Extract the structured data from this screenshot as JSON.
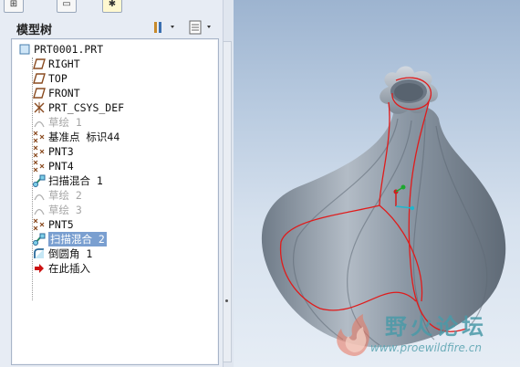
{
  "panel": {
    "title": "模型树"
  },
  "tree": {
    "root": "PRT0001.PRT",
    "items": [
      {
        "label": "RIGHT",
        "icon": "datum-plane-icon",
        "state": "normal"
      },
      {
        "label": "TOP",
        "icon": "datum-plane-icon",
        "state": "normal"
      },
      {
        "label": "FRONT",
        "icon": "datum-plane-icon",
        "state": "normal"
      },
      {
        "label": "PRT_CSYS_DEF",
        "icon": "csys-icon",
        "state": "normal"
      },
      {
        "label": "草绘 1",
        "icon": "sketch-icon",
        "state": "suppressed"
      },
      {
        "label": "基准点 标识44",
        "icon": "datum-point-icon",
        "state": "normal"
      },
      {
        "label": "PNT3",
        "icon": "datum-point-icon",
        "state": "normal"
      },
      {
        "label": "PNT4",
        "icon": "datum-point-icon",
        "state": "normal"
      },
      {
        "label": "扫描混合 1",
        "icon": "swept-blend-icon",
        "state": "normal"
      },
      {
        "label": "草绘 2",
        "icon": "sketch-icon",
        "state": "suppressed"
      },
      {
        "label": "草绘 3",
        "icon": "sketch-icon",
        "state": "suppressed"
      },
      {
        "label": "PNT5",
        "icon": "datum-point-icon",
        "state": "normal"
      },
      {
        "label": "扫描混合 2",
        "icon": "swept-blend-icon",
        "state": "selected"
      },
      {
        "label": "倒圆角 1",
        "icon": "round-icon",
        "state": "normal"
      },
      {
        "label": "在此插入",
        "icon": "insert-here-arrow-icon",
        "state": "normal"
      }
    ]
  },
  "watermark": {
    "title": "野火论坛",
    "url": "www.proewildfire.cn"
  },
  "colors": {
    "selection": "#7a9fd0",
    "suppressed_text": "#a4a4a4",
    "insert_arrow": "#cc1111",
    "model_surface": "#8e9aa6",
    "edge_highlight": "#e01b1b"
  }
}
